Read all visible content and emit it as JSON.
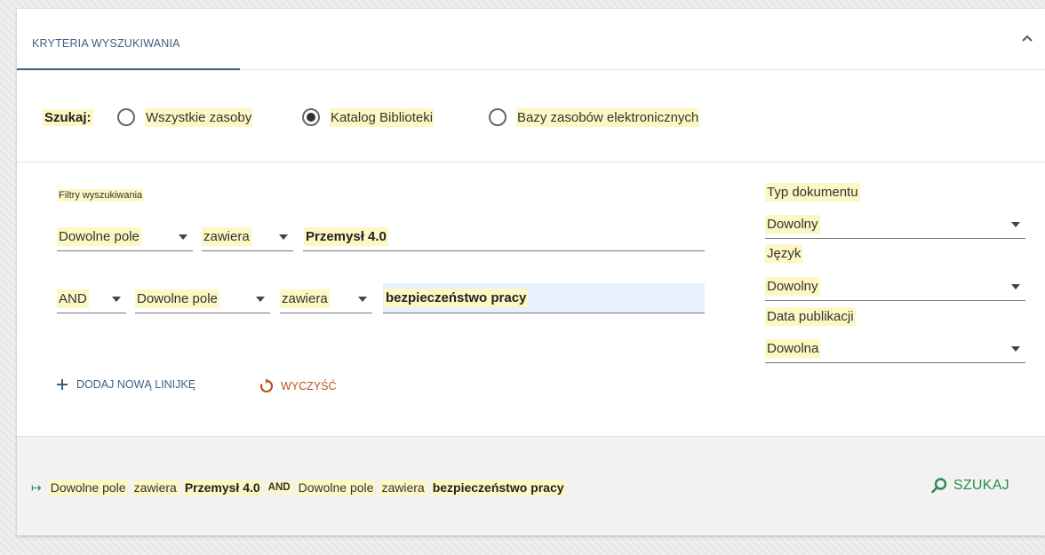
{
  "tab": {
    "label": "KRYTERIA WYSZUKIWANIA"
  },
  "scope": {
    "label": "Szukaj:",
    "options": [
      {
        "label": "Wszystkie zasoby",
        "selected": false
      },
      {
        "label": "Katalog Biblioteki",
        "selected": true
      },
      {
        "label": "Bazy zasobów elektronicznych",
        "selected": false
      }
    ]
  },
  "filters": {
    "title": "Filtry wyszukiwania",
    "rows": [
      {
        "field": "Dowolne pole",
        "condition": "zawiera",
        "value": "Przemysł 4.0"
      },
      {
        "operator": "AND",
        "field": "Dowolne pole",
        "condition": "zawiera",
        "value": "bezpieczeństwo pracy"
      }
    ],
    "add_line": "DODAJ NOWĄ LINIJKĘ",
    "clear": "WYCZYŚĆ"
  },
  "side": {
    "doc_type": {
      "label": "Typ dokumentu",
      "value": "Dowolny"
    },
    "language": {
      "label": "Język",
      "value": "Dowolny"
    },
    "pub_date": {
      "label": "Data publikacji",
      "value": "Dowolna"
    }
  },
  "summary": {
    "arrow": "↦",
    "parts": [
      "Dowolne pole",
      "zawiera",
      "Przemysł 4.0",
      "AND",
      "Dowolne pole",
      "zawiera",
      "bezpieczeństwo pracy"
    ]
  },
  "search_button": {
    "label": "SZUKAJ"
  },
  "colors": {
    "accent": "#3b5f82",
    "search": "#2a8a4a",
    "clear": "#b4541b",
    "highlight": "#fdf7c3",
    "active_input": "#e8f0fd"
  }
}
